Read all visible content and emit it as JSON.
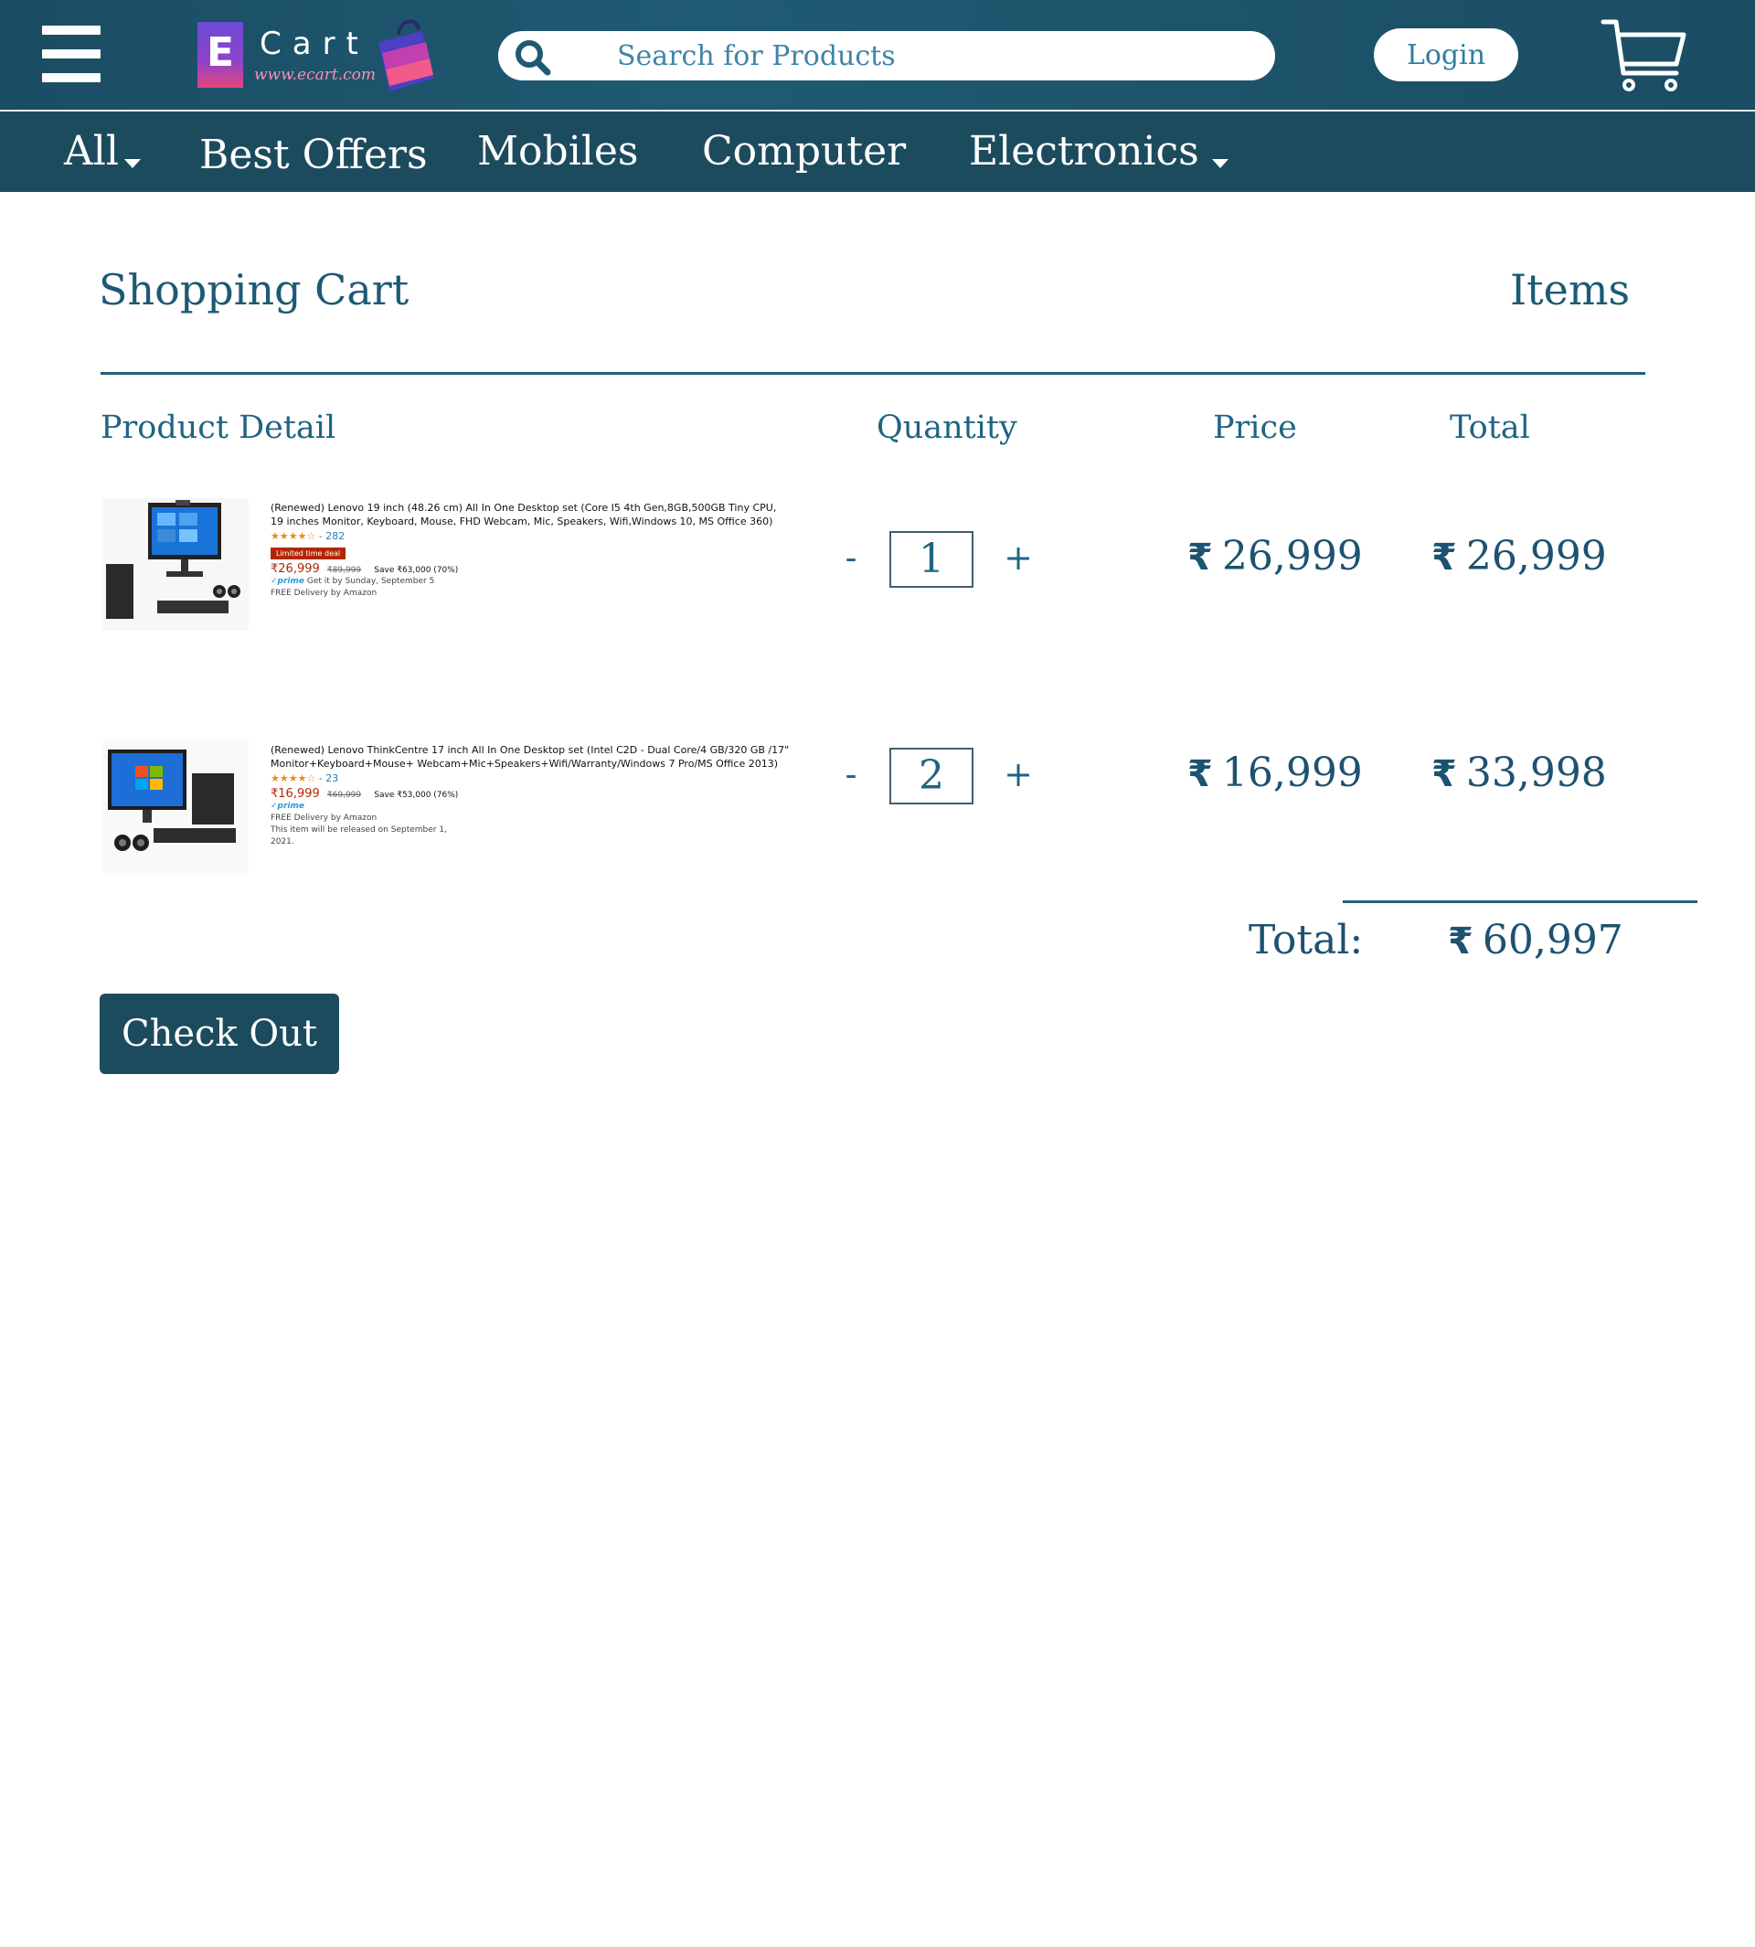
{
  "header": {
    "menu_icon": "hamburger-menu-icon",
    "logo": {
      "letter": "E",
      "name": "Cart",
      "url": "www.ecart.com"
    },
    "search": {
      "placeholder": "Search for Products",
      "value": "",
      "icon": "search-icon"
    },
    "login_label": "Login",
    "cart_icon": "shopping-cart-icon"
  },
  "nav": {
    "items": [
      {
        "label": "All",
        "dropdown": true
      },
      {
        "label": "Best Offers",
        "dropdown": false
      },
      {
        "label": "Mobiles",
        "dropdown": false
      },
      {
        "label": "Computer",
        "dropdown": false
      },
      {
        "label": "Electronics",
        "dropdown": true
      }
    ]
  },
  "cart": {
    "title": "Shopping Cart",
    "items_label": "Items",
    "columns": {
      "product": "Product Detail",
      "quantity": "Quantity",
      "price": "Price",
      "total": "Total"
    },
    "currency_symbol": "₹",
    "minus": "-",
    "plus": "+",
    "rows": [
      {
        "title": "(Renewed) Lenovo 19 inch (48.26 cm) All In One Desktop set (Core I5 4th Gen,8GB,500GB Tiny CPU, 19 inches Monitor, Keyboard, Mouse, FHD Webcam, Mic, Speakers, Wifi,Windows 10, MS Office 360)",
        "rating_stars": "★★★★☆",
        "rating_count": "282",
        "deal_badge": "Limited time deal",
        "listing_price": "₹26,999",
        "listing_mrp": "₹89,999",
        "listing_save": "Save ₹63,000 (70%)",
        "prime": "✓prime",
        "delivery_date": "Get it by Sunday, September 5",
        "delivery_note": "FREE Delivery by Amazon",
        "release_note": "",
        "quantity": "1",
        "price": "26,999",
        "total": "26,999"
      },
      {
        "title": "(Renewed) Lenovo ThinkCentre 17 inch All In One Desktop set (Intel C2D - Dual Core/4 GB/320 GB /17\" Monitor+Keyboard+Mouse+ Webcam+Mic+Speakers+Wifi/Warranty/Windows 7 Pro/MS Office 2013)",
        "rating_stars": "★★★★☆",
        "rating_count": "23",
        "deal_badge": "",
        "listing_price": "₹16,999",
        "listing_mrp": "₹69,999",
        "listing_save": "Save ₹53,000 (76%)",
        "prime": "✓prime",
        "delivery_date": "",
        "delivery_note": "FREE Delivery by Amazon",
        "release_note": "This item will be released on September 1, 2021.",
        "quantity": "2",
        "price": "16,999",
        "total": "33,998"
      }
    ],
    "grand_total_label": "Total:",
    "grand_total": "60,997",
    "checkout_label": "Check Out"
  },
  "colors": {
    "header_bg": "#1b4d63",
    "nav_bg": "#1d4b5e",
    "accent": "#1d5270",
    "price_red": "#b12704"
  }
}
